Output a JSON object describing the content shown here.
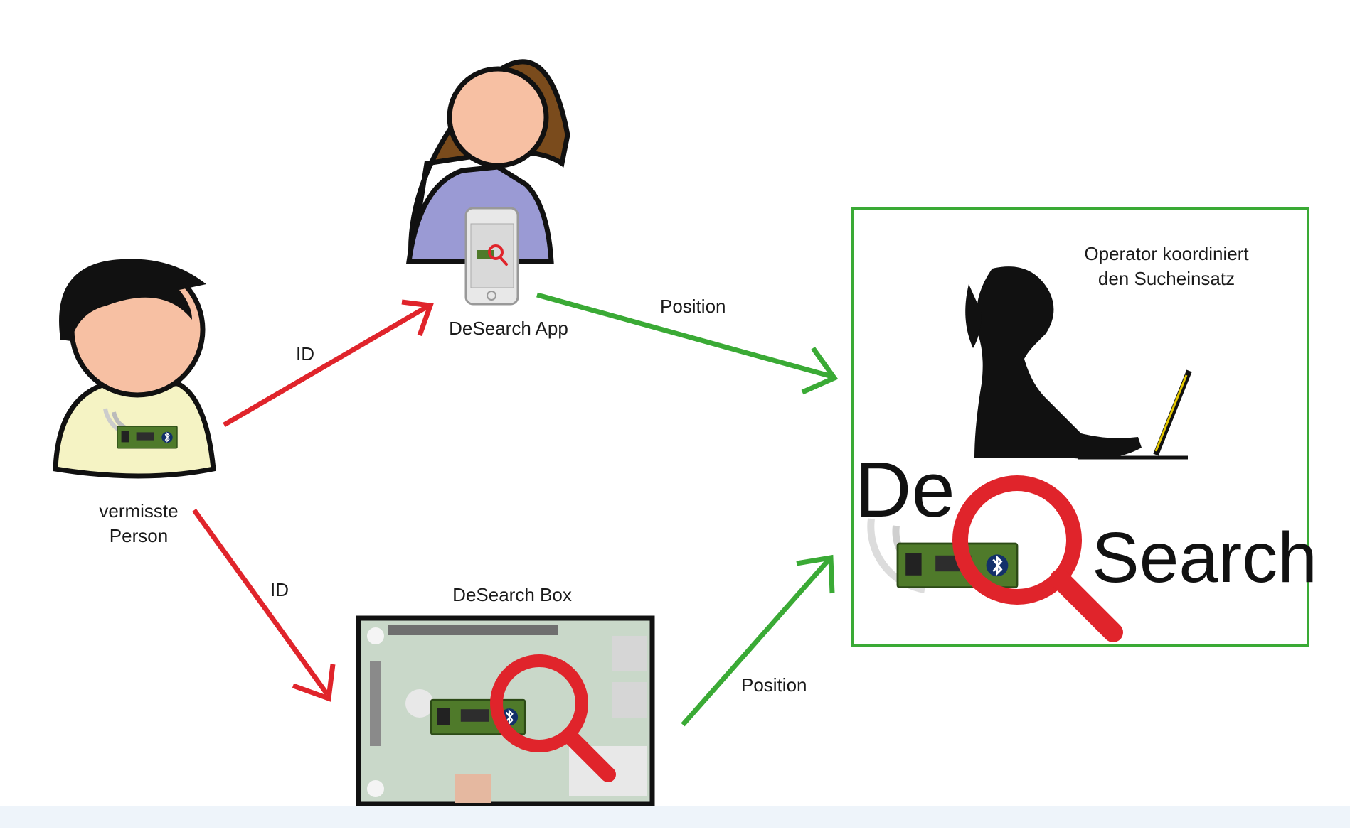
{
  "labels": {
    "person": "vermisste\nPerson",
    "app": "DeSearch App",
    "box": "DeSearch Box",
    "operator": "Operator koordiniert\nden Sucheinsatz",
    "id_top": "ID",
    "id_bottom": "ID",
    "position_top": "Position",
    "position_bottom": "Position"
  },
  "logo": {
    "part1": "De",
    "part2": "Search"
  },
  "colors": {
    "red_arrow": "#e0242b",
    "green_arrow": "#3aaa35",
    "operator_frame": "#3aaa35",
    "magnifier": "#e0242b",
    "person_hair": "#111111",
    "person_skin": "#f7c0a3",
    "person_shirt": "#f5f3c4",
    "app_user_hair": "#7a4b1c",
    "app_user_shirt": "#9a9ad4",
    "chip": "#4f7a2a"
  },
  "icons": [
    "person-icon",
    "app-user-icon",
    "smartphone-icon",
    "raspberry-pi-board-icon",
    "operator-silhouette-icon",
    "laptop-icon",
    "magnifier-icon",
    "bluetooth-icon",
    "chip-icon",
    "signal-waves-icon"
  ]
}
